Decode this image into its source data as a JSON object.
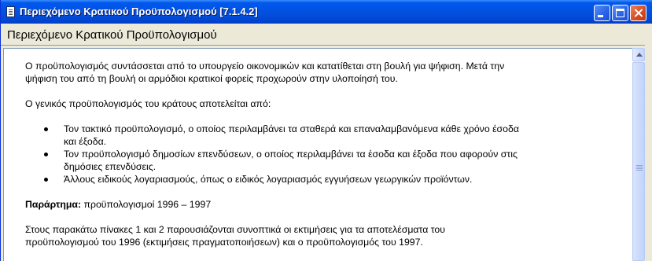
{
  "window": {
    "title": "Περιεχόμενο Κρατικού Προϋπολογισμού   [7.1.4.2]",
    "icon": "document-icon",
    "accent_color": "#0251E0"
  },
  "header": {
    "title": "Περιεχόμενο Κρατικού Προϋπολογισμού"
  },
  "content": {
    "para1_line1": "Ο προϋπολογισμός συντάσσεται από το υπουργείο οικονομικών και κατατίθεται στη βουλή για ψήφιση. Μετά την",
    "para1_line2": "ψήφιση του από τη βουλή οι αρμόδιοι κρατικοί φορείς προχωρούν στην υλοποίησή του.",
    "para2": "Ο γενικός προϋπολογισμός του κράτους αποτελείται από:",
    "bullets": [
      {
        "line1": "Τον τακτικό προϋπολογισμό, ο οποίος περιλαμβάνει τα σταθερά και επαναλαμβανόμενα κάθε χρόνο έσοδα",
        "line2": "και έξοδα."
      },
      {
        "line1": "Τον προϋπολογισμό δημοσίων επενδύσεων, ο οποίος περιλαμβάνει τα έσοδα και έξοδα που αφορούν στις",
        "line2": "δημόσιες επενδύσεις."
      },
      {
        "line1": "Άλλους ειδικούς λογαριασμούς, όπως ο ειδικός λογαριασμός εγγυήσεων γεωργικών προϊόντων.",
        "line2": ""
      }
    ],
    "appendix_label": "Παράρτημα:",
    "appendix_text": " προϋπολογισμοί 1996 – 1997",
    "para3_line1": "Στους παρακάτω πίνακες 1 και 2 παρουσιάζονται συνοπτικά οι εκτιμήσεις για τα αποτελέσματα του",
    "para3_line2": "προϋπολογισμού του 1996 (εκτιμήσεις πραγματοποιήσεων) και ο προϋπολογισμός του 1997."
  }
}
